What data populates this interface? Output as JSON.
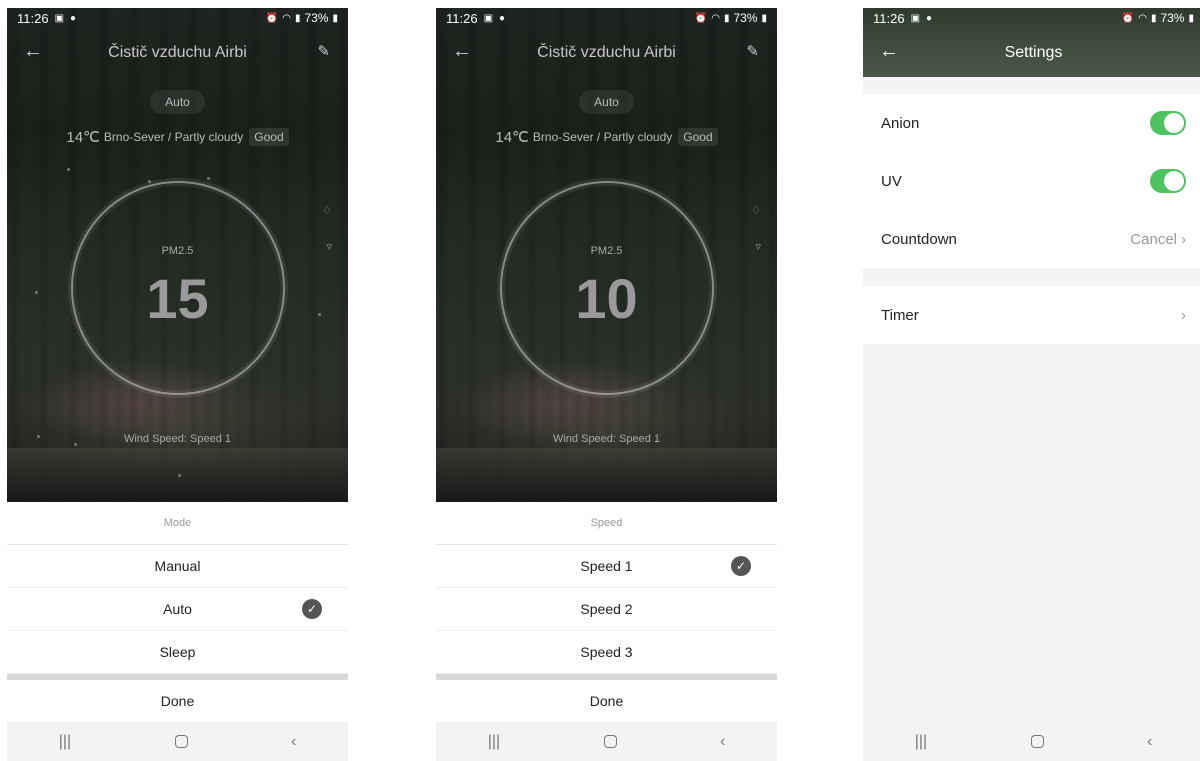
{
  "status": {
    "time": "11:26",
    "battery": "73%"
  },
  "panel1": {
    "title": "Čistič vzduchu Airbi",
    "mode": "Auto",
    "temperature": "14℃",
    "location": "Brno-Sever / Partly cloudy",
    "air_quality": "Good",
    "pm_label": "PM2.5",
    "pm_value": "15",
    "wind": "Wind Speed: Speed 1",
    "sheet_title": "Mode",
    "options": [
      "Manual",
      "Auto",
      "Sleep"
    ],
    "selected_index": 1,
    "done": "Done"
  },
  "panel2": {
    "title": "Čistič vzduchu Airbi",
    "mode": "Auto",
    "temperature": "14℃",
    "location": "Brno-Sever / Partly cloudy",
    "air_quality": "Good",
    "pm_label": "PM2.5",
    "pm_value": "10",
    "wind": "Wind Speed: Speed 1",
    "sheet_title": "Speed",
    "options": [
      "Speed 1",
      "Speed 2",
      "Speed 3"
    ],
    "selected_index": 0,
    "done": "Done"
  },
  "panel3": {
    "title": "Settings",
    "rows": {
      "anion": {
        "label": "Anion",
        "on": true
      },
      "uv": {
        "label": "UV",
        "on": true
      },
      "countdown": {
        "label": "Countdown",
        "value": "Cancel"
      },
      "timer": {
        "label": "Timer"
      }
    }
  },
  "icons": {
    "check": "checkmark-icon",
    "toggle_color": "#4cc35e"
  }
}
